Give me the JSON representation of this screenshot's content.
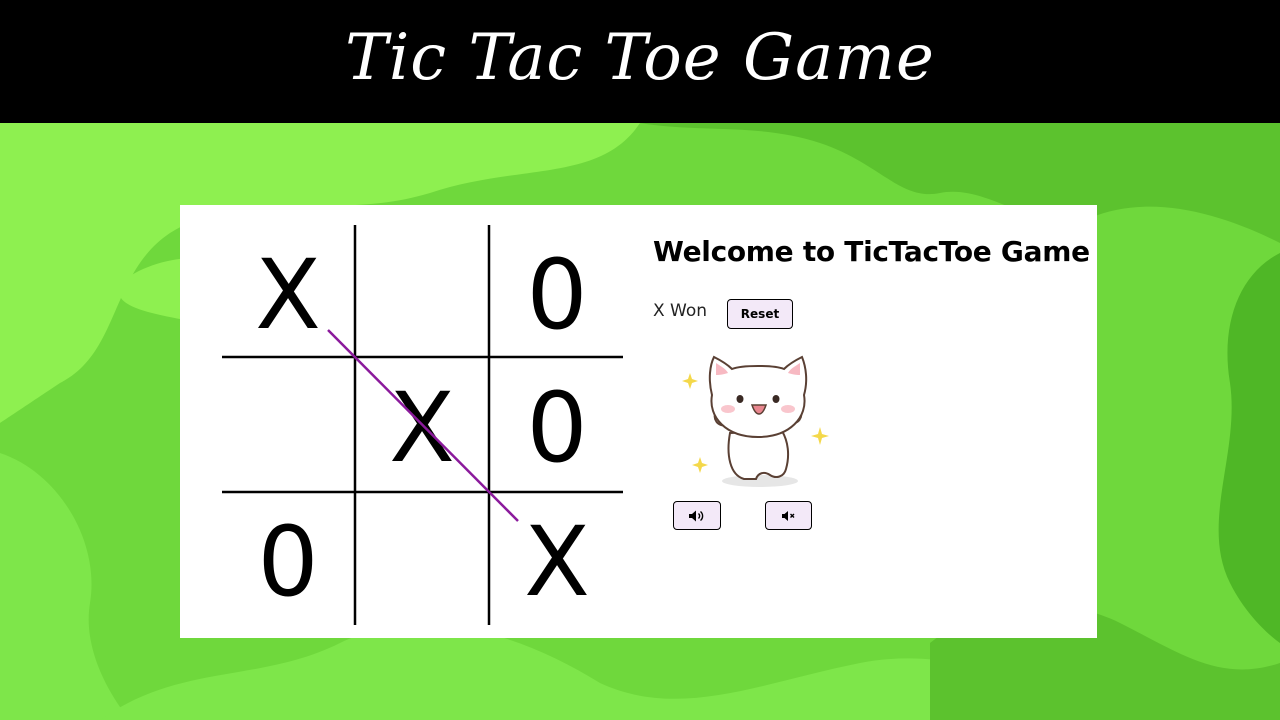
{
  "header": {
    "title": "Tic Tac Toe Game"
  },
  "game": {
    "welcome": "Welcome to TicTacToe Game",
    "status": "X Won",
    "reset_label": "Reset",
    "board": [
      [
        "X",
        "",
        "0"
      ],
      [
        "",
        "X",
        "0"
      ],
      [
        "0",
        "",
        "X"
      ]
    ],
    "winning_line": "diagonal",
    "winner": "X",
    "win_line_color": "#8b1a9c"
  },
  "controls": {
    "sound_on_icon": "speaker-on-icon",
    "sound_off_icon": "speaker-muted-icon"
  },
  "colors": {
    "banner_bg": "#000000",
    "banner_text": "#ffffff",
    "background_green": "#6fd83c",
    "button_bg": "#f3e9f8"
  }
}
